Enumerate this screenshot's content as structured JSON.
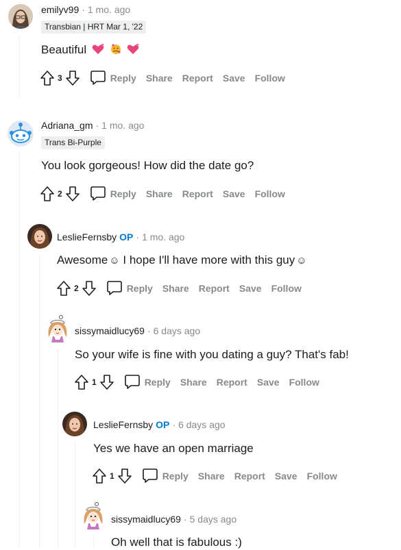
{
  "comments": [
    {
      "username": "emilyv99",
      "time": "1 mo. ago",
      "flair": "Transbian | HRT Mar 1, '22",
      "text": "Beautiful",
      "votes": "3",
      "actions": {
        "reply": "Reply",
        "share": "Share",
        "report": "Report",
        "save": "Save",
        "follow": "Follow"
      }
    },
    {
      "username": "Adriana_gm",
      "time": "1 mo. ago",
      "flair": "Trans Bi-Purple",
      "text": "You look gorgeous! How did the date go?",
      "votes": "2",
      "actions": {
        "reply": "Reply",
        "share": "Share",
        "report": "Report",
        "save": "Save",
        "follow": "Follow"
      }
    },
    {
      "username": "LeslieFernsby",
      "op": "OP",
      "time": "1 mo. ago",
      "text_a": "Awesome",
      "text_b": "I hope I'll have more with this guy",
      "smile": "☺",
      "votes": "2",
      "actions": {
        "reply": "Reply",
        "share": "Share",
        "report": "Report",
        "save": "Save",
        "follow": "Follow"
      }
    },
    {
      "username": "sissymaidlucy69",
      "time": "6 days ago",
      "text": "So your wife is fine with you dating a guy? That's fab!",
      "votes": "1",
      "actions": {
        "reply": "Reply",
        "share": "Share",
        "report": "Report",
        "save": "Save",
        "follow": "Follow"
      }
    },
    {
      "username": "LeslieFernsby",
      "op": "OP",
      "time": "6 days ago",
      "text": "Yes we have an open marriage",
      "votes": "1",
      "actions": {
        "reply": "Reply",
        "share": "Share",
        "report": "Report",
        "save": "Save",
        "follow": "Follow"
      }
    },
    {
      "username": "sissymaidlucy69",
      "time": "5 days ago",
      "text": "Oh well that is fabulous :)"
    }
  ],
  "separator": "·",
  "colors": {
    "op": "#0079d3",
    "muted": "#878a8c",
    "flair_bg": "#edeff1"
  },
  "icons": [
    "upvote-icon",
    "downvote-icon",
    "comment-bubble-icon",
    "heart-emoji-icon",
    "hugging-heart-emoji-icon"
  ]
}
